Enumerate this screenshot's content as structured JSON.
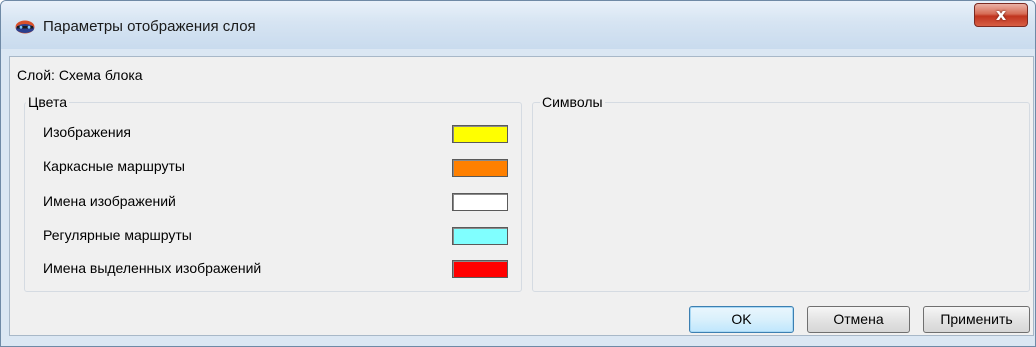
{
  "window": {
    "title": "Параметры отображения слоя",
    "close_glyph": "x"
  },
  "layer": {
    "label": "Слой: Схема блока"
  },
  "colors_group": {
    "title": "Цвета",
    "rows": [
      {
        "label": "Изображения",
        "color": "#ffff00"
      },
      {
        "label": "Каркасные маршруты",
        "color": "#ff8000"
      },
      {
        "label": "Имена изображений",
        "color": "#ffffff"
      },
      {
        "label": "Регулярные маршруты",
        "color": "#80ffff"
      },
      {
        "label": "Имена выделенных изображений",
        "color": "#ff0000"
      }
    ]
  },
  "symbols_group": {
    "title": "Символы"
  },
  "buttons": {
    "ok": "OK",
    "cancel": "Отмена",
    "apply": "Применить"
  }
}
